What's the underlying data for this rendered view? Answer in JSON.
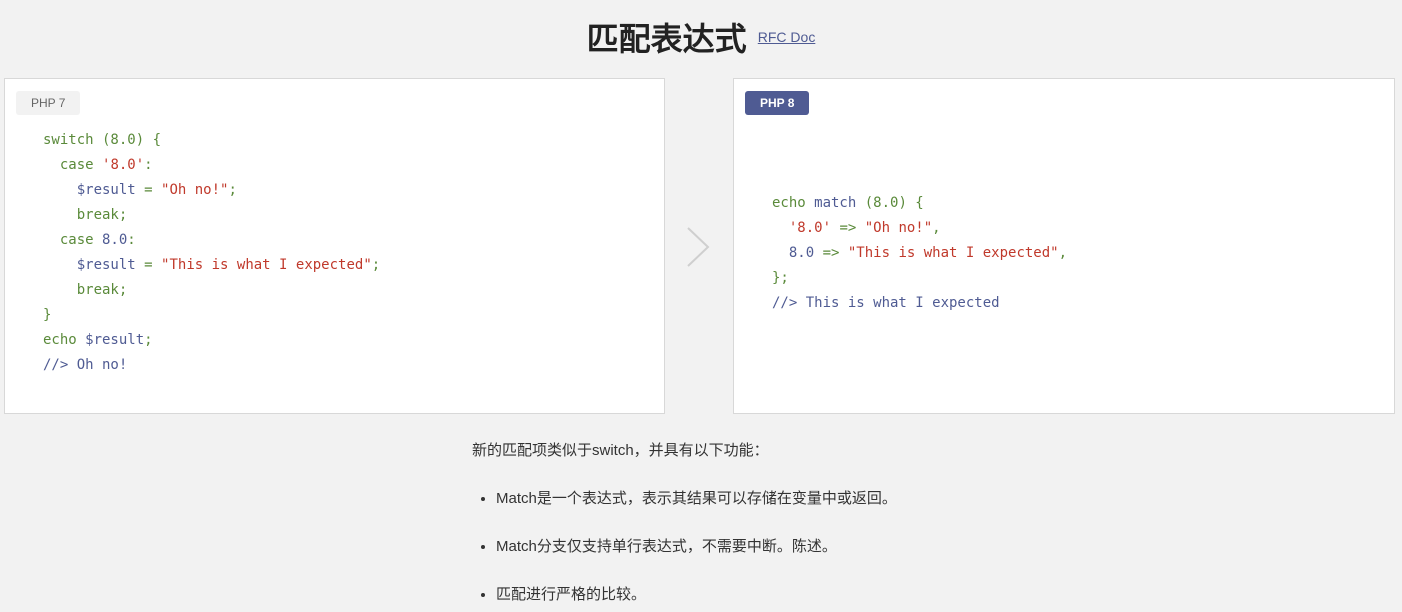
{
  "header": {
    "title": "匹配表达式",
    "rfc_link": "RFC Doc"
  },
  "panels": {
    "php7": {
      "badge": "PHP 7",
      "code": {
        "l1_kw": "switch",
        "l1_rest": " (8.0) {",
        "l2_kw": "case",
        "l2_str": "'8.0'",
        "l2_rest": ":",
        "l3_var": "$result",
        "l3_op": " = ",
        "l3_str": "\"Oh no!\"",
        "l3_end": ";",
        "l4_kw": "break",
        "l4_end": ";",
        "l5_kw": "case",
        "l5_num": " 8.0",
        "l5_end": ":",
        "l6_var": "$result",
        "l6_op": " = ",
        "l6_str": "\"This is what I expected\"",
        "l6_end": ";",
        "l7_kw": "break",
        "l7_end": ";",
        "l8": "}",
        "l9_kw": "echo",
        "l9_var": " $result",
        "l9_end": ";",
        "l10": "//> Oh no!"
      }
    },
    "php8": {
      "badge": "PHP 8",
      "code": {
        "l1_kw": "echo",
        "l1_fn": " match",
        "l1_rest": " (8.0) {",
        "l2_str": "'8.0'",
        "l2_op": " => ",
        "l2_str2": "\"Oh no!\"",
        "l2_end": ",",
        "l3_num": "8.0",
        "l3_op": " => ",
        "l3_str": "\"This is what I expected\"",
        "l3_end": ",",
        "l4": "};",
        "l5": "//> This is what I expected"
      }
    }
  },
  "description": {
    "intro": "新的匹配项类似于switch，并具有以下功能：",
    "bullets": [
      "Match是一个表达式，表示其结果可以存储在变量中或返回。",
      "Match分支仅支持单行表达式，不需要中断。陈述。",
      "匹配进行严格的比较。"
    ]
  },
  "colors": {
    "accent": "#4f5b93",
    "keyword": "#5a8a3a",
    "string": "#c0392b",
    "background": "#f2f2f2"
  },
  "icons": {
    "arrow": "chevron-right-icon"
  }
}
